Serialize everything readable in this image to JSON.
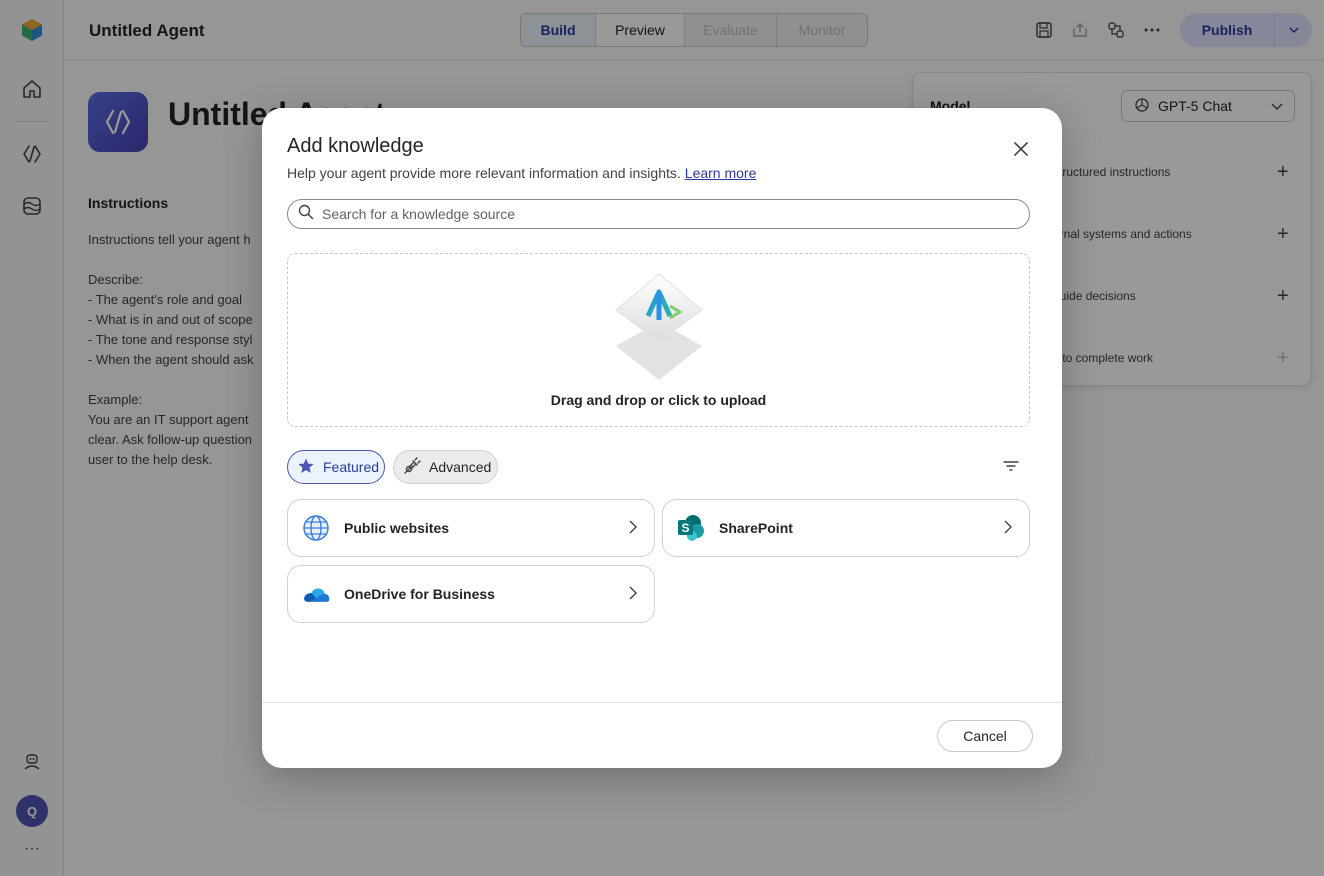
{
  "app": {
    "title": "Untitled Agent",
    "tabs": [
      {
        "label": "Build",
        "state": "active"
      },
      {
        "label": "Preview",
        "state": "normal"
      },
      {
        "label": "Evaluate",
        "state": "disabled"
      },
      {
        "label": "Monitor",
        "state": "disabled"
      }
    ],
    "publish_label": "Publish",
    "toolbar_icons": [
      "save-icon",
      "share-icon",
      "connection-icon",
      "more-icon"
    ]
  },
  "sidebar": {
    "icons": [
      "app-logo-icon",
      "home-icon",
      "agent-icon",
      "library-icon",
      "help-agent-icon"
    ],
    "avatar_initial": "Q",
    "more": "···"
  },
  "main": {
    "agent_name": "Untitled Agent",
    "instructions_heading": "Instructions",
    "instructions_text": "Instructions tell your agent h\n\nDescribe:\n- The agent's role and goal\n- What is in and out of scope\n- The tone and response styl\n- When the agent should ask\n\nExample:\nYou are an IT support agent\nclear. Ask follow-up question\nuser to the help desk."
  },
  "side_panel": {
    "model_label": "Model",
    "model_value": "GPT-5 Chat",
    "rows": [
      {
        "text": "structured instructions",
        "enabled": true
      },
      {
        "text": "ernal systems and actions",
        "enabled": true
      },
      {
        "text": "guide decisions",
        "enabled": true
      },
      {
        "text": "s to complete work",
        "enabled": false
      }
    ]
  },
  "dialog": {
    "title": "Add knowledge",
    "subtitle": "Help your agent provide more relevant information and insights.",
    "learn_more": "Learn more",
    "search_placeholder": "Search for a knowledge source",
    "upload_text": "Drag and drop or click to upload",
    "filters": [
      {
        "label": "Featured",
        "selected": true,
        "icon": "star-icon"
      },
      {
        "label": "Advanced",
        "selected": false,
        "icon": "plug-icon"
      }
    ],
    "sources": [
      {
        "label": "Public websites",
        "icon": "globe-icon"
      },
      {
        "label": "SharePoint",
        "icon": "sharepoint-icon"
      },
      {
        "label": "OneDrive for Business",
        "icon": "onedrive-icon"
      }
    ],
    "cancel_label": "Cancel"
  },
  "colors": {
    "accent": "#4f52b2",
    "accent_text": "#2b3a9b",
    "link": "#2b3a9b",
    "overlay": "rgba(0,0,0,0.40)"
  }
}
